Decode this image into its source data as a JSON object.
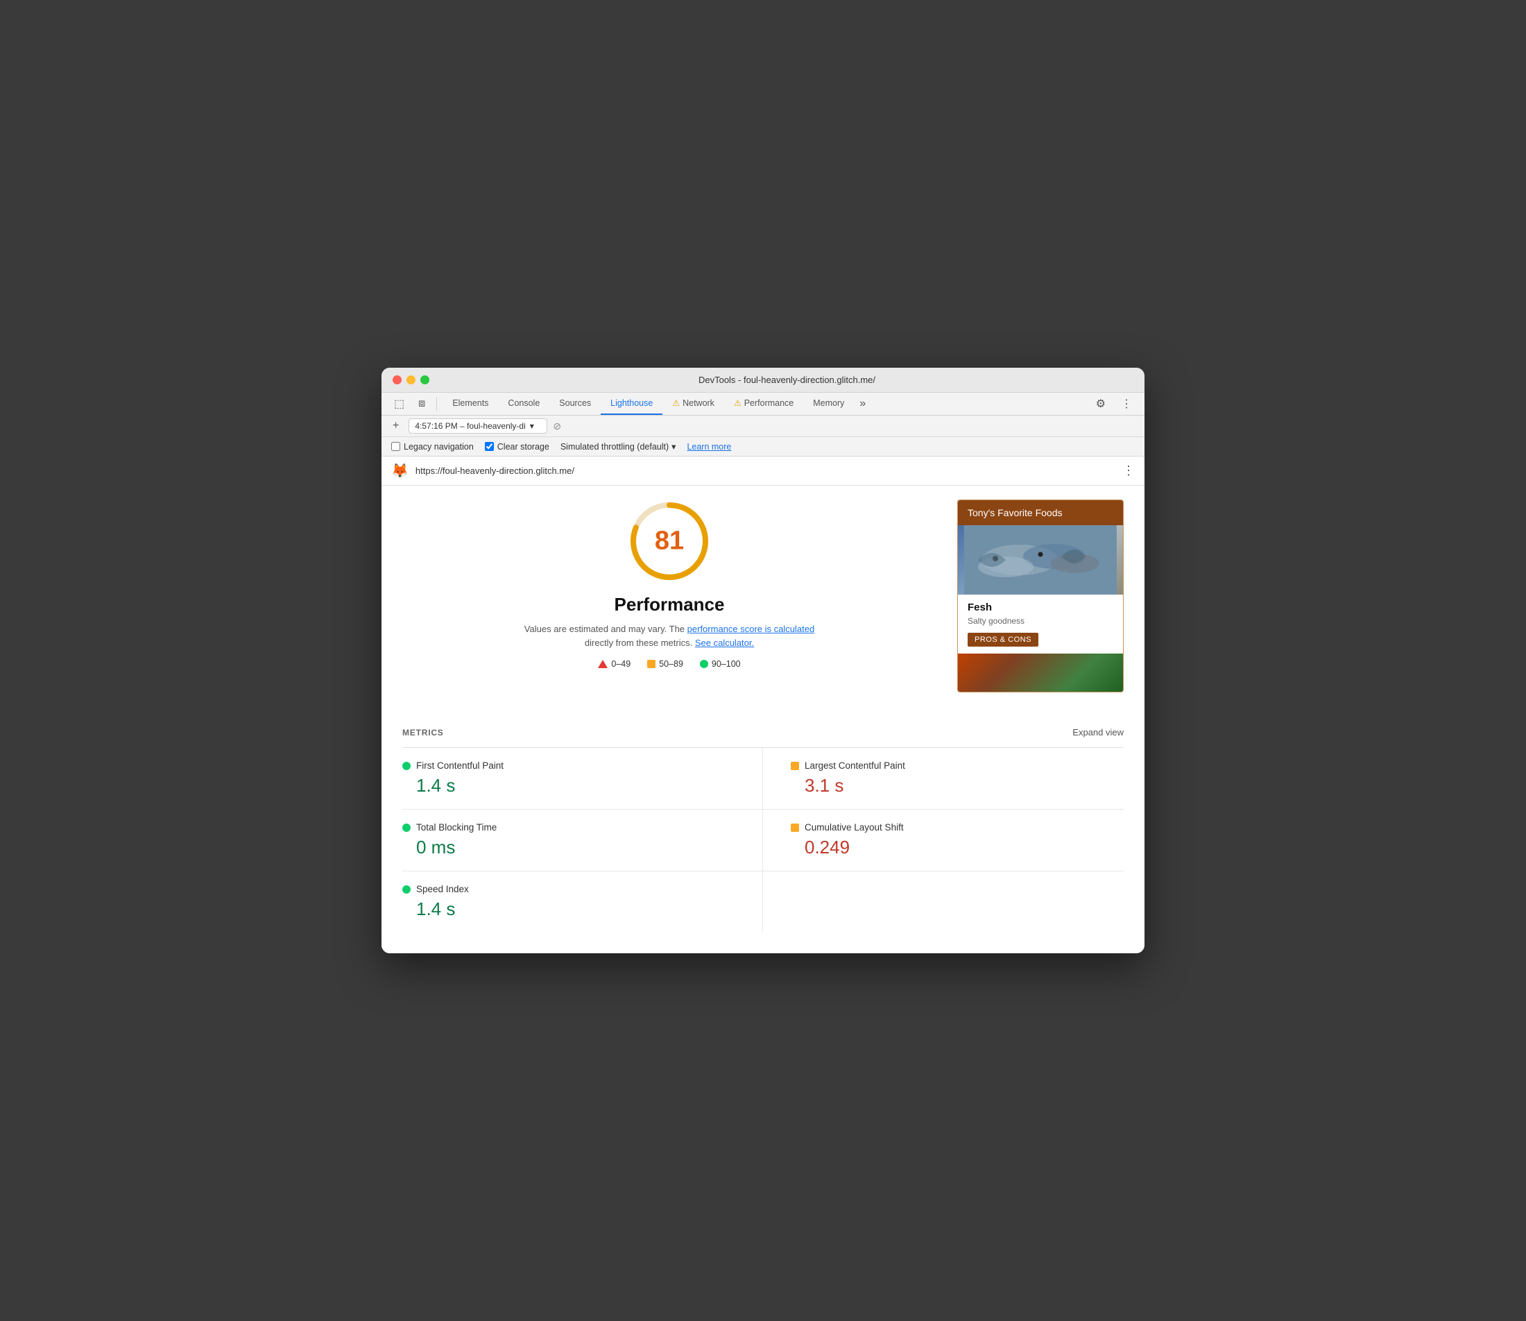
{
  "window": {
    "title": "DevTools - foul-heavenly-direction.glitch.me/"
  },
  "tabs": [
    {
      "label": "Elements",
      "active": false,
      "warning": false
    },
    {
      "label": "Console",
      "active": false,
      "warning": false
    },
    {
      "label": "Sources",
      "active": false,
      "warning": false
    },
    {
      "label": "Lighthouse",
      "active": true,
      "warning": false
    },
    {
      "label": "Network",
      "active": false,
      "warning": true
    },
    {
      "label": "Performance",
      "active": false,
      "warning": true
    },
    {
      "label": "Memory",
      "active": false,
      "warning": false
    }
  ],
  "urlbar": {
    "value": "4:57:16 PM – foul-heavenly-di",
    "placeholder": "4:57:16 PM – foul-heavenly-di"
  },
  "options": {
    "legacy_navigation_label": "Legacy navigation",
    "legacy_navigation_checked": false,
    "clear_storage_label": "Clear storage",
    "clear_storage_checked": true,
    "throttling_label": "Simulated throttling (default)",
    "learn_more_label": "Learn more"
  },
  "url_display": {
    "url": "https://foul-heavenly-direction.glitch.me/"
  },
  "score": {
    "value": 81,
    "title": "Performance",
    "description_text": "Values are estimated and may vary. The",
    "link1": "performance score is calculated",
    "link1_suffix": "directly from these metrics.",
    "link2": "See calculator.",
    "legend": [
      {
        "range": "0–49",
        "type": "triangle"
      },
      {
        "range": "50–89",
        "type": "square"
      },
      {
        "range": "90–100",
        "type": "circle"
      }
    ]
  },
  "preview": {
    "header": "Tony's Favorite Foods",
    "food_name": "Fesh",
    "food_desc": "Salty goodness",
    "btn_label": "PROS & CONS"
  },
  "metrics": {
    "label": "METRICS",
    "expand_label": "Expand view",
    "items": [
      {
        "name": "First Contentful Paint",
        "value": "1.4 s",
        "color": "green",
        "col": "left"
      },
      {
        "name": "Largest Contentful Paint",
        "value": "3.1 s",
        "color": "orange",
        "col": "right"
      },
      {
        "name": "Total Blocking Time",
        "value": "0 ms",
        "color": "green",
        "col": "left"
      },
      {
        "name": "Cumulative Layout Shift",
        "value": "0.249",
        "color": "orange",
        "col": "right"
      },
      {
        "name": "Speed Index",
        "value": "1.4 s",
        "color": "green",
        "col": "left"
      }
    ]
  }
}
